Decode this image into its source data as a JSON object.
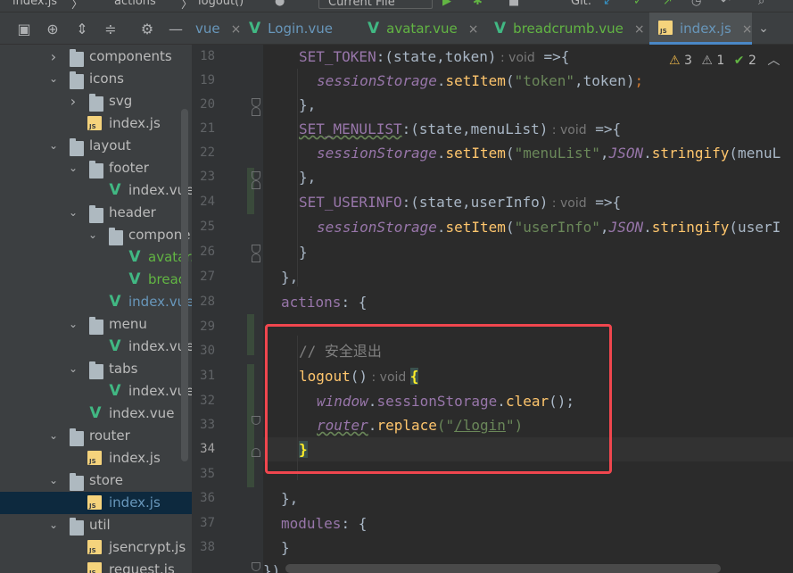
{
  "topbar": {
    "breadcrumb_file": "index.js",
    "breadcrumb_sep1": "〉",
    "breadcrumb_actions": "actions",
    "breadcrumb_sep2": "〉",
    "breadcrumb_logout": "logout()",
    "run_config": "Current File",
    "git_label": "Git:"
  },
  "tree": {
    "rows": [
      {
        "label": "components",
        "type": "folder",
        "level": 1,
        "state": "collapsed"
      },
      {
        "label": "icons",
        "type": "folder",
        "level": 1,
        "state": "expanded"
      },
      {
        "label": "svg",
        "type": "folder",
        "level": 2,
        "state": "collapsed"
      },
      {
        "label": "index.js",
        "type": "js",
        "level": 2
      },
      {
        "label": "layout",
        "type": "folder",
        "level": 1,
        "state": "expanded"
      },
      {
        "label": "footer",
        "type": "folder",
        "level": 2,
        "state": "expanded"
      },
      {
        "label": "index.vue",
        "type": "vue",
        "level": 3,
        "color": "default"
      },
      {
        "label": "header",
        "type": "folder",
        "level": 2,
        "state": "expanded"
      },
      {
        "label": "compone",
        "type": "folder",
        "level": 3,
        "state": "expanded"
      },
      {
        "label": "avatar.",
        "type": "vue",
        "level": 4,
        "color": "green"
      },
      {
        "label": "bread",
        "type": "vue",
        "level": 4,
        "color": "green"
      },
      {
        "label": "index.vue",
        "type": "vue",
        "level": 3,
        "color": "blue"
      },
      {
        "label": "menu",
        "type": "folder",
        "level": 2,
        "state": "expanded"
      },
      {
        "label": "index.vue",
        "type": "vue",
        "level": 3,
        "color": "default"
      },
      {
        "label": "tabs",
        "type": "folder",
        "level": 2,
        "state": "expanded"
      },
      {
        "label": "index.vue",
        "type": "vue",
        "level": 3,
        "color": "default"
      },
      {
        "label": "index.vue",
        "type": "vue",
        "level": 2,
        "color": "default"
      },
      {
        "label": "router",
        "type": "folder",
        "level": 1,
        "state": "expanded"
      },
      {
        "label": "index.js",
        "type": "js",
        "level": 2
      },
      {
        "label": "store",
        "type": "folder",
        "level": 1,
        "state": "expanded"
      },
      {
        "label": "index.js",
        "type": "js",
        "level": 2,
        "selected": true
      },
      {
        "label": "util",
        "type": "folder",
        "level": 1,
        "state": "expanded"
      },
      {
        "label": "jsencrypt.js",
        "type": "js",
        "level": 2
      },
      {
        "label": "request.js",
        "type": "js",
        "level": 2
      }
    ]
  },
  "tabs": [
    {
      "label": "vue",
      "kind": "partial"
    },
    {
      "label": "Login.vue",
      "kind": "vue",
      "color": "blue"
    },
    {
      "label": "avatar.vue",
      "kind": "vue",
      "color": "green"
    },
    {
      "label": "breadcrumb.vue",
      "kind": "vue",
      "color": "green"
    },
    {
      "label": "index.js",
      "kind": "js",
      "color": "blue",
      "active": true
    }
  ],
  "tab_close_glyph": "×",
  "inspections": {
    "warnings": "3",
    "weak_warnings": "1",
    "ok": "2"
  },
  "editor": {
    "line_numbers": [
      "18",
      "19",
      "20",
      "21",
      "22",
      "23",
      "24",
      "25",
      "26",
      "27",
      "28",
      "29",
      "30",
      "31",
      "32",
      "33",
      "34",
      "35",
      "36",
      "37",
      "38"
    ],
    "current_line": "34",
    "code": {
      "l18_name": "SET_TOKEN",
      "l18_sig": ":(state,token)",
      "l18_hint": " : void",
      "l18_arrow": " =>{",
      "l19_obj": "sessionStorage",
      "l19_dot": ".",
      "l19_method": "setItem",
      "l19_open": "(",
      "l19_str": "\"token\"",
      "l19_rest": ",token)",
      "l19_semi": ";",
      "l20": "},",
      "l21_name": "SET_MENULIST",
      "l21_sig": ":(state,menuList)",
      "l21_hint": " : void",
      "l21_arrow": " =>{",
      "l22_obj": "sessionStorage",
      "l22_method": "setItem",
      "l22_str": "\"menuList\"",
      "l22_json": "JSON",
      "l22_stringify": "stringify",
      "l22_rest": "(menuL",
      "l23": "},",
      "l24_name": "SET_USERINFO",
      "l24_sig": ":(state,userInfo)",
      "l24_hint": " : void",
      "l24_arrow": " =>{",
      "l25_obj": "sessionStorage",
      "l25_method": "setItem",
      "l25_str": "\"userInfo\"",
      "l25_json": "JSON",
      "l25_stringify": "stringify",
      "l25_rest": "(userI",
      "l26": "}",
      "l27": "},",
      "l28_key": "actions",
      "l28_rest": ": {",
      "l30_comment": "// 安全退出",
      "l31_name": "logout",
      "l31_parens": "()",
      "l31_hint": " : void ",
      "l31_brace": "{",
      "l32_window": "window",
      "l32_dot1": ".",
      "l32_ss": "sessionStorage",
      "l32_dot2": ".",
      "l32_clear": "clear",
      "l32_rest": "();",
      "l33_router": "router",
      "l33_dot": ".",
      "l33_replace": "replace",
      "l33_open": "(\"",
      "l33_path": "/login",
      "l33_close": "\")",
      "l34_brace": "}",
      "l36": "},",
      "l37_key": "modules",
      "l37_rest": ": {",
      "l38": "}",
      "l39": "})"
    }
  },
  "colors": {
    "annotation": "#f0464e",
    "selection": "#0d293e",
    "active_tab_underline": "#4a88c7"
  }
}
